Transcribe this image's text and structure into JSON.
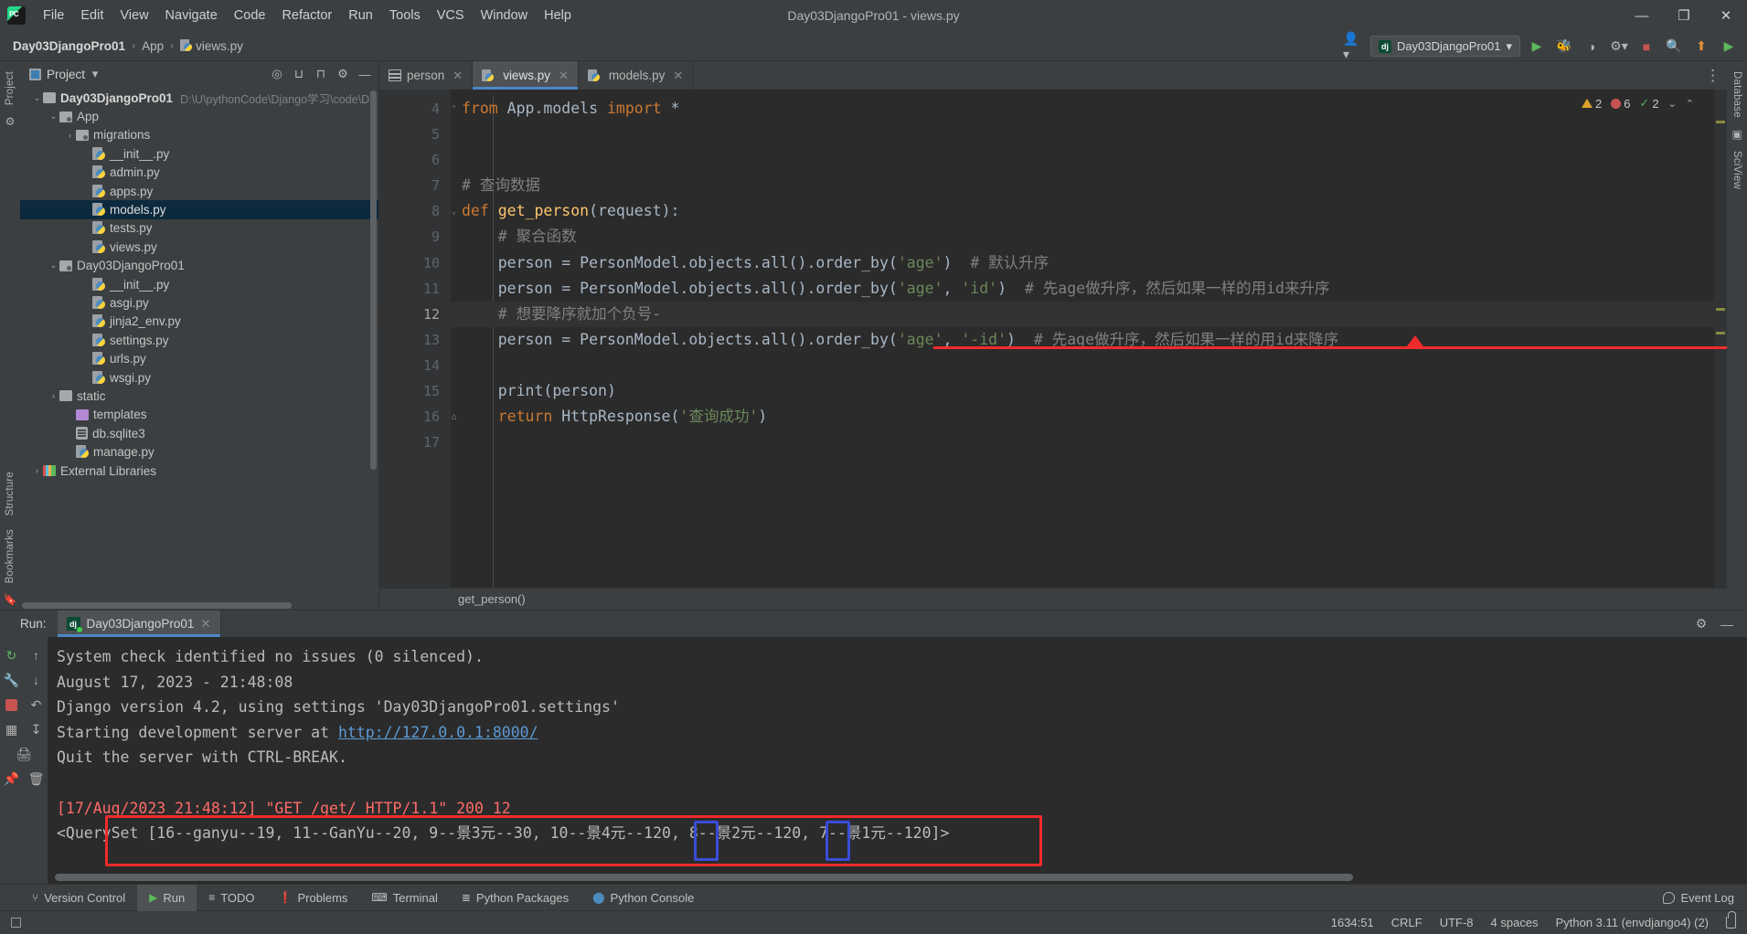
{
  "window": {
    "title": "Day03DjangoPro01 - views.py",
    "minimize": "—",
    "maximize": "❐",
    "close": "✕"
  },
  "menubar": {
    "logo_name": "pycharm-logo",
    "items": [
      "File",
      "Edit",
      "View",
      "Navigate",
      "Code",
      "Refactor",
      "Run",
      "Tools",
      "VCS",
      "Window",
      "Help"
    ]
  },
  "breadcrumb": {
    "project": "Day03DjangoPro01",
    "folder": "App",
    "file": "views.py",
    "separator": "›"
  },
  "toolbar": {
    "account_icon": "user-icon",
    "run_config": "Day03DjangoPro01",
    "chevron": "▾",
    "run_icon": "▶",
    "debug_icon": "🐞",
    "coverage_icon": "◑",
    "profile_icon": "⚙",
    "stop_icon": "■",
    "search_icon": "⚲",
    "update_icon": "⬆",
    "more_icon": "▶"
  },
  "sidebar_rails": {
    "left": [
      "Project",
      "Structure",
      "Bookmarks"
    ],
    "right": [
      "Database",
      "SciView"
    ]
  },
  "project_panel": {
    "title": "Project",
    "dropdown": "▾",
    "actions": [
      "locate-icon",
      "expand-all-icon",
      "collapse-all-icon",
      "settings-icon",
      "hide-icon"
    ],
    "tree": [
      {
        "label": "Day03DjangoPro01",
        "path": "D:\\U\\pythonCode\\Django学习\\code\\D",
        "indent": 0,
        "arrow": "⌄",
        "icon": "folder",
        "bold": true,
        "selected": false
      },
      {
        "label": "App",
        "path": "",
        "indent": 1,
        "arrow": "⌄",
        "icon": "folder-src",
        "bold": false,
        "selected": false
      },
      {
        "label": "migrations",
        "path": "",
        "indent": 2,
        "arrow": "›",
        "icon": "folder-src",
        "bold": false,
        "selected": false
      },
      {
        "label": "__init__.py",
        "path": "",
        "indent": 3,
        "arrow": "",
        "icon": "python",
        "bold": false,
        "selected": false
      },
      {
        "label": "admin.py",
        "path": "",
        "indent": 3,
        "arrow": "",
        "icon": "python",
        "bold": false,
        "selected": false
      },
      {
        "label": "apps.py",
        "path": "",
        "indent": 3,
        "arrow": "",
        "icon": "python",
        "bold": false,
        "selected": false
      },
      {
        "label": "models.py",
        "path": "",
        "indent": 3,
        "arrow": "",
        "icon": "python",
        "bold": false,
        "selected": true
      },
      {
        "label": "tests.py",
        "path": "",
        "indent": 3,
        "arrow": "",
        "icon": "python",
        "bold": false,
        "selected": false
      },
      {
        "label": "views.py",
        "path": "",
        "indent": 3,
        "arrow": "",
        "icon": "python",
        "bold": false,
        "selected": false
      },
      {
        "label": "Day03DjangoPro01",
        "path": "",
        "indent": 1,
        "arrow": "⌄",
        "icon": "folder-src",
        "bold": false,
        "selected": false
      },
      {
        "label": "__init__.py",
        "path": "",
        "indent": 3,
        "arrow": "",
        "icon": "python",
        "bold": false,
        "selected": false
      },
      {
        "label": "asgi.py",
        "path": "",
        "indent": 3,
        "arrow": "",
        "icon": "python",
        "bold": false,
        "selected": false
      },
      {
        "label": "jinja2_env.py",
        "path": "",
        "indent": 3,
        "arrow": "",
        "icon": "python",
        "bold": false,
        "selected": false
      },
      {
        "label": "settings.py",
        "path": "",
        "indent": 3,
        "arrow": "",
        "icon": "python",
        "bold": false,
        "selected": false
      },
      {
        "label": "urls.py",
        "path": "",
        "indent": 3,
        "arrow": "",
        "icon": "python",
        "bold": false,
        "selected": false
      },
      {
        "label": "wsgi.py",
        "path": "",
        "indent": 3,
        "arrow": "",
        "icon": "python",
        "bold": false,
        "selected": false
      },
      {
        "label": "static",
        "path": "",
        "indent": 1,
        "arrow": "›",
        "icon": "folder",
        "bold": false,
        "selected": false
      },
      {
        "label": "templates",
        "path": "",
        "indent": 2,
        "arrow": "",
        "icon": "folder-purple",
        "bold": false,
        "selected": false
      },
      {
        "label": "db.sqlite3",
        "path": "",
        "indent": 2,
        "arrow": "",
        "icon": "db",
        "bold": false,
        "selected": false
      },
      {
        "label": "manage.py",
        "path": "",
        "indent": 2,
        "arrow": "",
        "icon": "python",
        "bold": false,
        "selected": false
      },
      {
        "label": "External Libraries",
        "path": "",
        "indent": 0,
        "arrow": "›",
        "icon": "lib",
        "bold": false,
        "selected": false
      }
    ]
  },
  "editor": {
    "tabs": [
      {
        "label": "person",
        "icon": "table-icon",
        "active": false,
        "closable": true
      },
      {
        "label": "views.py",
        "icon": "python-icon",
        "active": true,
        "closable": true
      },
      {
        "label": "models.py",
        "icon": "python-icon",
        "active": false,
        "closable": true
      }
    ],
    "more_icon": "⋮",
    "inspection": {
      "warnings": "2",
      "errors": "6",
      "ok": "2",
      "check_glyph": "✓",
      "chevron_down": "⌄",
      "chevron_up": "⌃"
    },
    "lines": [
      {
        "num": "4",
        "fold": "⌃",
        "current": false,
        "tokens": [
          {
            "t": "from",
            "c": "kw"
          },
          {
            "t": " App.models ",
            "c": "pun"
          },
          {
            "t": "import",
            "c": "kw"
          },
          {
            "t": " *",
            "c": "pun"
          }
        ]
      },
      {
        "num": "5",
        "fold": "",
        "current": false,
        "tokens": []
      },
      {
        "num": "6",
        "fold": "",
        "current": false,
        "tokens": []
      },
      {
        "num": "7",
        "fold": "",
        "current": false,
        "tokens": [
          {
            "t": "# 查询数据",
            "c": "cmt"
          }
        ]
      },
      {
        "num": "8",
        "fold": "⌄",
        "current": false,
        "tokens": [
          {
            "t": "def ",
            "c": "kw"
          },
          {
            "t": "get_person",
            "c": "fn"
          },
          {
            "t": "(request):",
            "c": "pun"
          }
        ]
      },
      {
        "num": "9",
        "fold": "",
        "current": false,
        "tokens": [
          {
            "t": "    # 聚合函数",
            "c": "cmt"
          }
        ]
      },
      {
        "num": "10",
        "fold": "",
        "current": false,
        "tokens": [
          {
            "t": "    person = PersonModel.objects.all().order_by(",
            "c": "pun"
          },
          {
            "t": "'age'",
            "c": "st"
          },
          {
            "t": ")  ",
            "c": "pun"
          },
          {
            "t": "# 默认升序",
            "c": "cmt"
          }
        ]
      },
      {
        "num": "11",
        "fold": "",
        "current": false,
        "tokens": [
          {
            "t": "    person = PersonModel.objects.all().order_by(",
            "c": "pun"
          },
          {
            "t": "'age'",
            "c": "st"
          },
          {
            "t": ", ",
            "c": "pun"
          },
          {
            "t": "'id'",
            "c": "st"
          },
          {
            "t": ")  ",
            "c": "pun"
          },
          {
            "t": "# 先age做升序，然后如果一样的用id来升序",
            "c": "cmt"
          }
        ]
      },
      {
        "num": "12",
        "fold": "",
        "current": true,
        "tokens": [
          {
            "t": "    # 想要降序就加个负号-",
            "c": "cmt"
          }
        ]
      },
      {
        "num": "13",
        "fold": "",
        "current": false,
        "tokens": [
          {
            "t": "    person = PersonModel.objects.all().order_by(",
            "c": "pun"
          },
          {
            "t": "'age'",
            "c": "st"
          },
          {
            "t": ", ",
            "c": "pun"
          },
          {
            "t": "'-id'",
            "c": "st"
          },
          {
            "t": ")  ",
            "c": "pun"
          },
          {
            "t": "# 先age做升序，然后如果一样的用id来降序",
            "c": "cmt"
          }
        ]
      },
      {
        "num": "14",
        "fold": "",
        "current": false,
        "tokens": []
      },
      {
        "num": "15",
        "fold": "",
        "current": false,
        "tokens": [
          {
            "t": "    print(person)",
            "c": "pun"
          }
        ]
      },
      {
        "num": "16",
        "fold": "⌂",
        "current": false,
        "tokens": [
          {
            "t": "    return ",
            "c": "kw"
          },
          {
            "t": "HttpResponse(",
            "c": "pun"
          },
          {
            "t": "'查询成功'",
            "c": "st"
          },
          {
            "t": ")",
            "c": "pun"
          }
        ]
      },
      {
        "num": "17",
        "fold": "",
        "current": false,
        "tokens": []
      }
    ],
    "status_strip": "get_person()"
  },
  "run_panel": {
    "label": "Run:",
    "tab": "Day03DjangoPro01",
    "tab_close": "✕",
    "settings_icon": "⚙",
    "hide_icon": "—",
    "rail_icons": [
      "rerun-icon",
      "scroll-up-icon",
      "wrench-icon",
      "scroll-down-icon",
      "stop-icon",
      "soft-wrap-icon",
      "layout-icon",
      "scroll-end-icon",
      "print-icon",
      "pin-icon",
      "trash-icon"
    ],
    "console_lines": [
      {
        "text": "System check identified no issues (0 silenced).",
        "style": "plain"
      },
      {
        "text": "August 17, 2023 - 21:48:08",
        "style": "plain"
      },
      {
        "text": "Django version 4.2, using settings 'Day03DjangoPro01.settings'",
        "style": "plain"
      },
      {
        "text": "Starting development server at ",
        "style": "link",
        "link": "http://127.0.0.1:8000/"
      },
      {
        "text": "Quit the server with CTRL-BREAK.",
        "style": "plain"
      },
      {
        "text": "",
        "style": "plain"
      },
      {
        "text": "[17/Aug/2023 21:48:12] \"GET /get/ HTTP/1.1\" 200 12",
        "style": "red"
      },
      {
        "text": "<QuerySet [16--ganyu--19, 11--GanYu--20, 9--景3元--30, 10--景4元--120, 8--景2元--120, 7--景1元--120]>",
        "style": "plain"
      }
    ]
  },
  "annotations": {
    "underline_color": "#f02b2b",
    "box_color": "#f02b2b",
    "highlight_box_color": "#3b4cd8"
  },
  "bottom_toolbar": {
    "tabs": [
      {
        "label": "Version Control",
        "icon": "branch-icon",
        "active": false
      },
      {
        "label": "Run",
        "icon": "play-icon",
        "active": true
      },
      {
        "label": "TODO",
        "icon": "list-icon",
        "active": false
      },
      {
        "label": "Problems",
        "icon": "exclamation-icon",
        "active": false
      },
      {
        "label": "Terminal",
        "icon": "terminal-icon",
        "active": false
      },
      {
        "label": "Python Packages",
        "icon": "stack-icon",
        "active": false
      },
      {
        "label": "Python Console",
        "icon": "python-icon",
        "active": false
      }
    ],
    "event_log": "Event Log"
  },
  "statusbar": {
    "position": "1634:51",
    "line_sep": "CRLF",
    "encoding": "UTF-8",
    "indent": "4 spaces",
    "interpreter": "Python 3.11 (envdjango4) (2)",
    "lock_icon": "lock-icon"
  }
}
